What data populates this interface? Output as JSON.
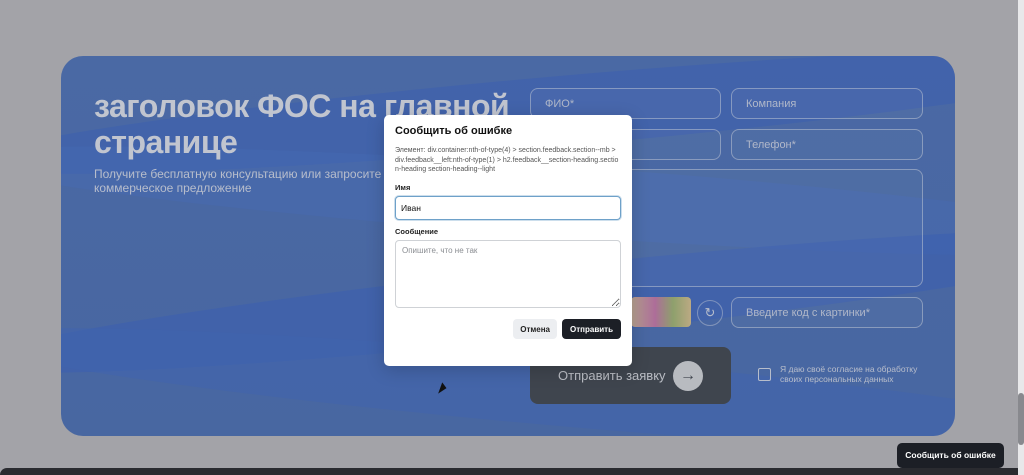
{
  "section": {
    "title": "заголовок ФОС на главной странице",
    "subtitle": "Получите бесплатную консультацию или запросите коммерческое предложение",
    "fields": {
      "fio": "ФИО*",
      "company": "Компания",
      "phone": "Телефон*",
      "captcha": "Введите код с картинки*"
    },
    "submit_label": "Отправить заявку",
    "consent_text": "Я даю своё согласие на обработку своих персональных данных"
  },
  "modal": {
    "title": "Сообщить об ошибке",
    "element_path": "Элемент: div.container:nth-of-type(4) > section.feedback.section--mb > div.feedback__left:nth-of-type(1) > h2.feedback__section-heading.section-heading section-heading--light",
    "name_label": "Имя",
    "name_value": "Иван",
    "message_label": "Сообщение",
    "message_placeholder": "Опишите, что не так",
    "cancel_label": "Отмена",
    "send_label": "Отправить"
  },
  "report_button_label": "Сообщить об ошибке",
  "colors": {
    "section_bg": "#3c67b8",
    "modal_bg": "#ffffff",
    "dark_button": "#1c1f26"
  }
}
